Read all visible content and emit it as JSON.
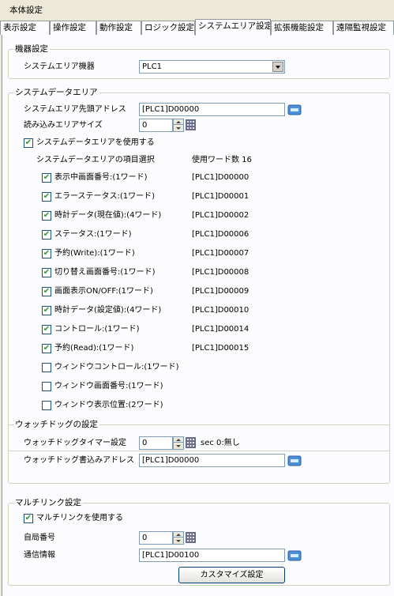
{
  "window_title": "本体設定",
  "tabs": [
    {
      "label": "表示設定"
    },
    {
      "label": "操作設定"
    },
    {
      "label": "動作設定"
    },
    {
      "label": "ロジック設定"
    },
    {
      "label": "システムエリア設定"
    },
    {
      "label": "拡張機能設定"
    },
    {
      "label": "遠隔監視設定"
    }
  ],
  "device_group": {
    "legend": "機器設定",
    "label": "システムエリア機器",
    "value": "PLC1"
  },
  "sysdata_group": {
    "legend": "システムデータエリア",
    "start_addr_label": "システムエリア先頭アドレス",
    "start_addr_value": "[PLC1]D00000",
    "read_size_label": "読み込みエリアサイズ",
    "read_size_value": "0",
    "use_label": "システムデータエリアを使用する",
    "use_checked": true,
    "items_header": "システムデータエリアの項目選択",
    "words_header": "使用ワード数 16",
    "items": [
      {
        "label": "表示中画面番号:(1ワード)",
        "addr": "[PLC1]D00000",
        "checked": true
      },
      {
        "label": "エラーステータス:(1ワード)",
        "addr": "[PLC1]D00001",
        "checked": true
      },
      {
        "label": "時計データ(現在値):(4ワード)",
        "addr": "[PLC1]D00002",
        "checked": true
      },
      {
        "label": "ステータス:(1ワード)",
        "addr": "[PLC1]D00006",
        "checked": true
      },
      {
        "label": "予約(Write):(1ワード)",
        "addr": "[PLC1]D00007",
        "checked": true
      },
      {
        "label": "切り替え画面番号:(1ワード)",
        "addr": "[PLC1]D00008",
        "checked": true
      },
      {
        "label": "画面表示ON/OFF:(1ワード)",
        "addr": "[PLC1]D00009",
        "checked": true
      },
      {
        "label": "時計データ(設定値):(4ワード)",
        "addr": "[PLC1]D00010",
        "checked": true
      },
      {
        "label": "コントロール:(1ワード)",
        "addr": "[PLC1]D00014",
        "checked": true
      },
      {
        "label": "予約(Read):(1ワード)",
        "addr": "[PLC1]D00015",
        "checked": true
      },
      {
        "label": "ウィンドウコントロール:(1ワード)",
        "addr": "",
        "checked": false
      },
      {
        "label": "ウィンドウ画面番号:(1ワード)",
        "addr": "",
        "checked": false
      },
      {
        "label": "ウィンドウ表示位置:(2ワード)",
        "addr": "",
        "checked": false
      }
    ]
  },
  "watchdog_group": {
    "legend": "ウォッチドッグの設定",
    "timer_label": "ウォッチドッグタイマー設定",
    "timer_value": "0",
    "timer_unit": "sec 0:無し",
    "addr_label": "ウォッチドッグ書込みアドレス",
    "addr_value": "[PLC1]D00000"
  },
  "multilink_group": {
    "legend": "マルチリンク設定",
    "use_label": "マルチリンクを使用する",
    "use_checked": true,
    "station_label": "自局番号",
    "station_value": "0",
    "comm_label": "通信情報",
    "comm_value": "[PLC1]D00100",
    "customize_button": "カスタマイズ設定"
  },
  "colors": {
    "background": "#ece9d8",
    "panel": "#fcfcfe",
    "check_mark": "#21a121",
    "input_border": "#7f9db9"
  },
  "icons": {
    "address_ref": "address-input-icon",
    "keypad": "keypad-icon",
    "spinner": "spinner-icon",
    "dropdown": "chevron-down-icon",
    "check": "check-icon"
  }
}
